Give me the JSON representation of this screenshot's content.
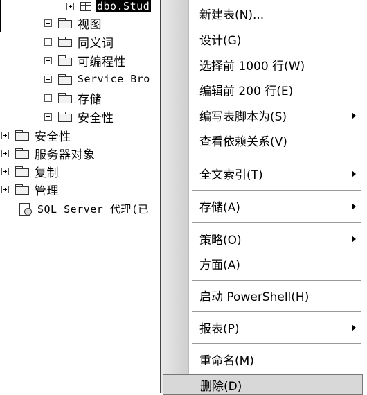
{
  "tree": {
    "nodes": [
      {
        "label": "dbo.Stud",
        "type": "table",
        "selected": true
      },
      {
        "label": "视图",
        "type": "folder"
      },
      {
        "label": "同义词",
        "type": "folder"
      },
      {
        "label": "可编程性",
        "type": "folder"
      },
      {
        "label": "Service Bro",
        "type": "folder",
        "mono": true
      },
      {
        "label": "存储",
        "type": "folder"
      },
      {
        "label": "安全性",
        "type": "folder"
      },
      {
        "label": "安全性",
        "type": "folder"
      },
      {
        "label": "服务器对象",
        "type": "folder"
      },
      {
        "label": "复制",
        "type": "folder"
      },
      {
        "label": "管理",
        "type": "folder"
      },
      {
        "label": "SQL Server 代理(已",
        "type": "agent"
      }
    ]
  },
  "context_menu": {
    "items": [
      {
        "label": "新建表(N)...",
        "submenu": false
      },
      {
        "label": "设计(G)",
        "submenu": false
      },
      {
        "label": "选择前 1000 行(W)",
        "submenu": false
      },
      {
        "label": "编辑前 200 行(E)",
        "submenu": false
      },
      {
        "label": "编写表脚本为(S)",
        "submenu": true
      },
      {
        "label": "查看依赖关系(V)",
        "submenu": false
      },
      {
        "label": "全文索引(T)",
        "submenu": true
      },
      {
        "label": "存储(A)",
        "submenu": true
      },
      {
        "label": "策略(O)",
        "submenu": true
      },
      {
        "label": "方面(A)",
        "submenu": false
      },
      {
        "label": "启动 PowerShell(H)",
        "submenu": false
      },
      {
        "label": "报表(P)",
        "submenu": true
      },
      {
        "label": "重命名(M)",
        "submenu": false
      },
      {
        "label": "删除(D)",
        "submenu": false,
        "highlighted": true
      }
    ]
  }
}
